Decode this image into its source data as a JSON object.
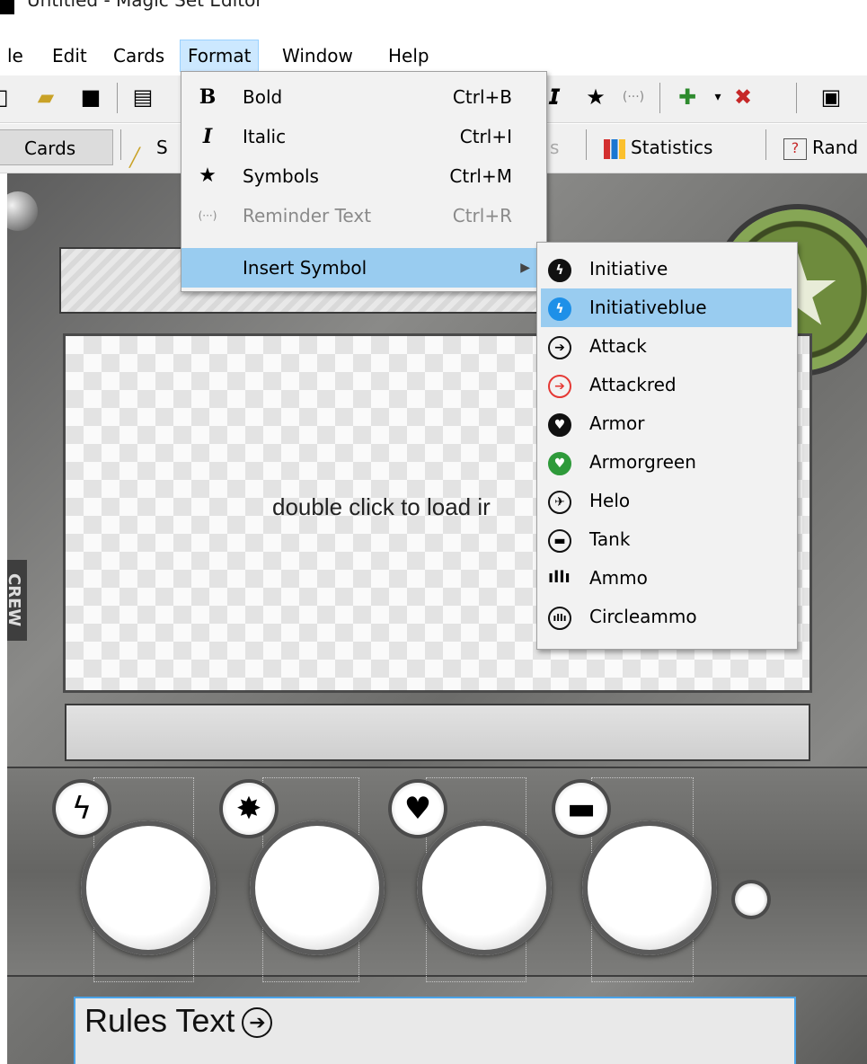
{
  "window": {
    "title": "Untitled - Magic Set Editor"
  },
  "menubar": {
    "items": [
      "le",
      "Edit",
      "Cards",
      "Format",
      "Window",
      "Help"
    ],
    "active": "Format"
  },
  "tabs": [
    {
      "label": "Cards",
      "active": true
    },
    {
      "label": "S",
      "active": false
    },
    {
      "label": "s",
      "active": false
    },
    {
      "label": "Statistics",
      "active": false
    },
    {
      "label": "Rand",
      "active": false
    }
  ],
  "format_menu": {
    "items": [
      {
        "icon": "B",
        "label": "Bold",
        "shortcut": "Ctrl+B",
        "enabled": true
      },
      {
        "icon": "I",
        "label": "Italic",
        "shortcut": "Ctrl+I",
        "enabled": true
      },
      {
        "icon": "★",
        "label": "Symbols",
        "shortcut": "Ctrl+M",
        "enabled": true
      },
      {
        "icon": "(···)",
        "label": "Reminder Text",
        "shortcut": "Ctrl+R",
        "enabled": false
      },
      {
        "icon": "",
        "label": "Insert Symbol",
        "shortcut": "",
        "enabled": true,
        "highlighted": true,
        "has_submenu": true
      }
    ]
  },
  "insert_symbol_menu": {
    "items": [
      {
        "label": "Initiative",
        "icon": "initiative-icon",
        "color": "#111111"
      },
      {
        "label": "Initiativeblue",
        "icon": "initiative-blue-icon",
        "color": "#1e90e8",
        "highlighted": true
      },
      {
        "label": "Attack",
        "icon": "attack-icon",
        "color": "#111111"
      },
      {
        "label": "Attackred",
        "icon": "attack-red-icon",
        "color": "#e53935"
      },
      {
        "label": "Armor",
        "icon": "armor-icon",
        "color": "#111111"
      },
      {
        "label": "Armorgreen",
        "icon": "armor-green-icon",
        "color": "#2e9a3a"
      },
      {
        "label": "Helo",
        "icon": "helo-icon",
        "color": "#111111"
      },
      {
        "label": "Tank",
        "icon": "tank-icon",
        "color": "#111111"
      },
      {
        "label": "Ammo",
        "icon": "ammo-icon",
        "color": "#111111"
      },
      {
        "label": "Circleammo",
        "icon": "circle-ammo-icon",
        "color": "#111111"
      }
    ]
  },
  "card": {
    "image_placeholder": "double click to load ir",
    "side_label": "CREW",
    "rules_text": "Rules Text"
  }
}
